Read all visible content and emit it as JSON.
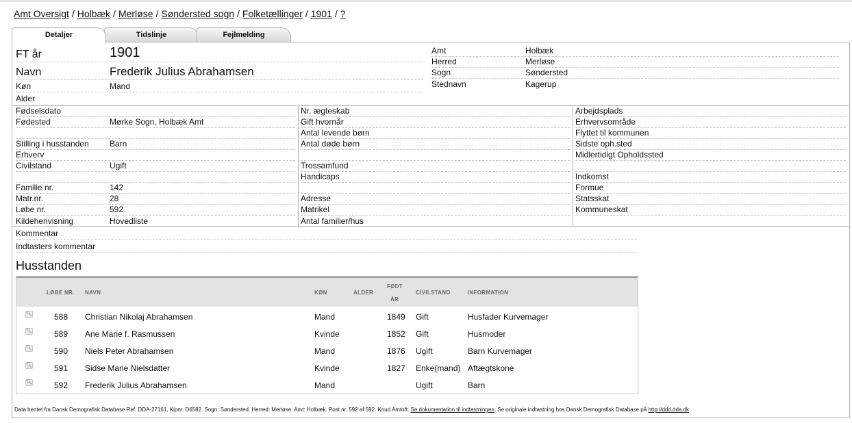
{
  "breadcrumb": {
    "items": [
      "Amt Oversigt",
      "Holbæk",
      "Merløse",
      "Søndersted sogn",
      "Folketællinger",
      "1901",
      "?"
    ],
    "separator": "/"
  },
  "tabs": [
    "Detaljer",
    "Tidslinje",
    "Fejlmelding"
  ],
  "top": {
    "ft_label": "FT år",
    "ft_value": "1901",
    "name_label": "Navn",
    "name_value": "Frederik Julius Abrahamsen",
    "gender_label": "Køn",
    "gender_value": "Mand",
    "age_label": "Alder",
    "age_value": ""
  },
  "location": [
    {
      "label": "Amt",
      "value": "Holbæk"
    },
    {
      "label": "Herred",
      "value": "Merløse"
    },
    {
      "label": "Sogn",
      "value": "Søndersted"
    },
    {
      "label": "Stednavn",
      "value": "Kagerup"
    }
  ],
  "col1": [
    {
      "label": "Fødselsdato",
      "value": ""
    },
    {
      "label": "Fødested",
      "value": "Mørke Sogn, Holbæk Amt"
    },
    {
      "label": "",
      "value": ""
    },
    {
      "label": "Stilling i husstanden",
      "value": "Barn"
    },
    {
      "label": "Erhverv",
      "value": ""
    },
    {
      "label": "Civilstand",
      "value": "Ugift"
    },
    {
      "label": "",
      "value": ""
    },
    {
      "label": "Familie nr.",
      "value": "142"
    },
    {
      "label": "Matr.nr.",
      "value": "28"
    },
    {
      "label": "Løbe nr.",
      "value": "592"
    },
    {
      "label": "Kildehenvisning",
      "value": "Hovedliste"
    }
  ],
  "col2": [
    {
      "label": "Nr. ægteskab"
    },
    {
      "label": "Gift hvornår"
    },
    {
      "label": "Antal levende børn"
    },
    {
      "label": "Antal døde børn"
    },
    {
      "label": ""
    },
    {
      "label": "Trossamfund"
    },
    {
      "label": "Handicaps"
    },
    {
      "label": ""
    },
    {
      "label": "Adresse"
    },
    {
      "label": "Matrikel"
    },
    {
      "label": "Antal familier/hus"
    }
  ],
  "col3": [
    {
      "label": "Arbejdsplads"
    },
    {
      "label": "Erhvervsområde"
    },
    {
      "label": "Flyttet til kommunen"
    },
    {
      "label": "Sidste oph.sted"
    },
    {
      "label": "Midlertidigt Opholdssted"
    },
    {
      "label": ""
    },
    {
      "label": "Indkomst"
    },
    {
      "label": "Formue"
    },
    {
      "label": "Statsskat"
    },
    {
      "label": "Kommuneskat"
    }
  ],
  "comments": {
    "comment_label": "Kommentar",
    "typist_comment_label": "Indtasters kommentar"
  },
  "household": {
    "title": "Husstanden",
    "columns": {
      "lobe": "LØBE NR.",
      "navn": "NAVN",
      "kon": "KØN",
      "alder": "ALDER",
      "fodt1": "FØDT",
      "fodt2": "ÅR",
      "civil": "CIVILSTAND",
      "info": "INFORMATION"
    },
    "rows": [
      {
        "nr": "588",
        "name": "Christian Nikolaj Abrahamsen",
        "gender": "Mand",
        "age": "",
        "born": "1849",
        "civil": "Gift",
        "info": "Husfader Kurvemager"
      },
      {
        "nr": "589",
        "name": "Ane Marie f. Rasmussen",
        "gender": "Kvinde",
        "age": "",
        "born": "1852",
        "civil": "Gift",
        "info": "Husmoder"
      },
      {
        "nr": "590",
        "name": "Niels Peter Abrahamsen",
        "gender": "Mand",
        "age": "",
        "born": "1876",
        "civil": "Ugift",
        "info": "Barn Kurvemager"
      },
      {
        "nr": "591",
        "name": "Sidse Marie Nielsdatter",
        "gender": "Kvinde",
        "age": "",
        "born": "1827",
        "civil": "Enke(mand)",
        "info": "Aftægtskone"
      },
      {
        "nr": "592",
        "name": "Frederik Julius Abrahamsen",
        "gender": "Mand",
        "age": "",
        "born": "",
        "civil": "Ugift",
        "info": "Barn"
      }
    ]
  },
  "footer": {
    "text": "Data hentet fra Dansk Demografisk Database Ref. DDA-27161, Kipnr. D6582. Sogn: Søndersted. Herred: Merløse. Amt: Holbæk. Post nr. 592 af 592. Knud Amtoft.",
    "link1": "Se dokumentation til indtastningen",
    "mid": ". Se originale indtastning hos Dansk Demografisk Database på",
    "link2": "http://ddd.dda.dk"
  }
}
